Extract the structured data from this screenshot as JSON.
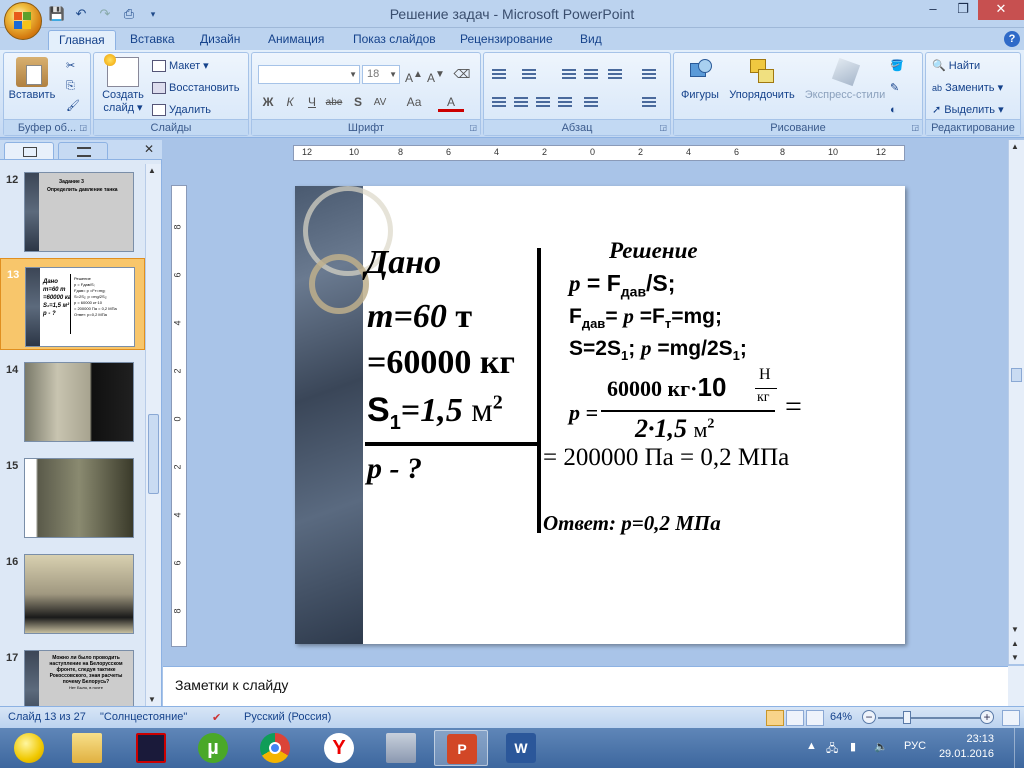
{
  "window": {
    "title": "Решение задач - Microsoft PowerPoint",
    "controls": {
      "minimize": "–",
      "restore": "❐",
      "close": "✕"
    }
  },
  "tabs": [
    {
      "label": "Главная",
      "active": true
    },
    {
      "label": "Вставка"
    },
    {
      "label": "Дизайн"
    },
    {
      "label": "Анимация"
    },
    {
      "label": "Показ слайдов"
    },
    {
      "label": "Рецензирование"
    },
    {
      "label": "Вид"
    }
  ],
  "help_label": "?",
  "ribbon": {
    "clipboard": {
      "label": "Буфер об...",
      "paste": "Вставить"
    },
    "slides": {
      "label": "Слайды",
      "new_slide_1": "Создать",
      "new_slide_2": "слайд ▾",
      "layout": "Макет ▾",
      "reset": "Восстановить",
      "delete": "Удалить"
    },
    "font": {
      "label": "Шрифт",
      "font_name": "",
      "font_size": "18",
      "bold": "Ж",
      "italic": "К",
      "underline": "Ч",
      "strike": "abe",
      "shadow": "S",
      "spacing": "AV",
      "case": "Аа",
      "color": "A"
    },
    "paragraph": {
      "label": "Абзац"
    },
    "drawing": {
      "label": "Рисование",
      "shapes": "Фигуры",
      "arrange": "Упорядочить",
      "styles": "Экспресс-стили"
    },
    "editing": {
      "label": "Редактирование",
      "find": "Найти",
      "replace": "Заменить ▾",
      "select": "Выделить ▾"
    }
  },
  "left_pane": {
    "thumbs": [
      {
        "num": "12",
        "title": "Задание 3",
        "subtitle": "Определить давление танка"
      },
      {
        "num": "13",
        "selected": true
      },
      {
        "num": "14"
      },
      {
        "num": "15"
      },
      {
        "num": "16"
      },
      {
        "num": "17",
        "text": "Можно ли было проводить наступление на Белорусском фронте, следуя тактике Рокоссовского, зная расчеты почему Белорусь?",
        "subtext": "Нет Было, в почте"
      }
    ]
  },
  "ruler": {
    "h_ticks": [
      "12",
      "10",
      "8",
      "6",
      "4",
      "2",
      "0",
      "2",
      "4",
      "6",
      "8",
      "10",
      "12"
    ],
    "v_ticks": [
      "8",
      "6",
      "4",
      "2",
      "0",
      "2",
      "4",
      "6",
      "8"
    ]
  },
  "slide": {
    "given_title": "Дано",
    "mass_label": "m=60",
    "mass_unit": "т",
    "mass_converted": "=60000 кг",
    "area_label": "S",
    "area_sub": "1",
    "area_eq": "=",
    "area_value": "1,5",
    "area_unit": "м",
    "area_pow": "2",
    "unknown": "p - ?",
    "solution_title": "Решение",
    "f1_p": "p",
    "f1_rest": " = F",
    "f1_sub": "дав",
    "f1_end": "/S;",
    "f2_a": "F",
    "f2_sub1": "дав",
    "f2_b": "= ",
    "f2_p": "p",
    "f2_c": " =F",
    "f2_sub2": "т",
    "f2_d": "=mg;",
    "f3_a": "S=2S",
    "f3_sub1": "1",
    "f3_b": "; ",
    "f3_p": "p",
    "f3_c": " =mg/2S",
    "f3_sub2": "1",
    "f3_d": ";",
    "f4_p": "p =",
    "num_a": "60000 кг·",
    "num_b": "10",
    "frac_top": "Н",
    "frac_bot": "кг",
    "den": "2·1,5",
    "den_unit": "м",
    "den_pow": "2",
    "eq_tail": "=",
    "result": "= 200000 Па = 0,2 МПа",
    "answer": "Ответ: p=0,2 МПа"
  },
  "notes": {
    "placeholder": "Заметки к слайду"
  },
  "status": {
    "slide": "Слайд 13 из 27",
    "theme": "\"Солнцестояние\"",
    "lang": "Русский (Россия)",
    "zoom": "64%"
  },
  "taskbar": {
    "tray_lang": "РУС",
    "time": "23:13",
    "date": "29.01.2016"
  }
}
